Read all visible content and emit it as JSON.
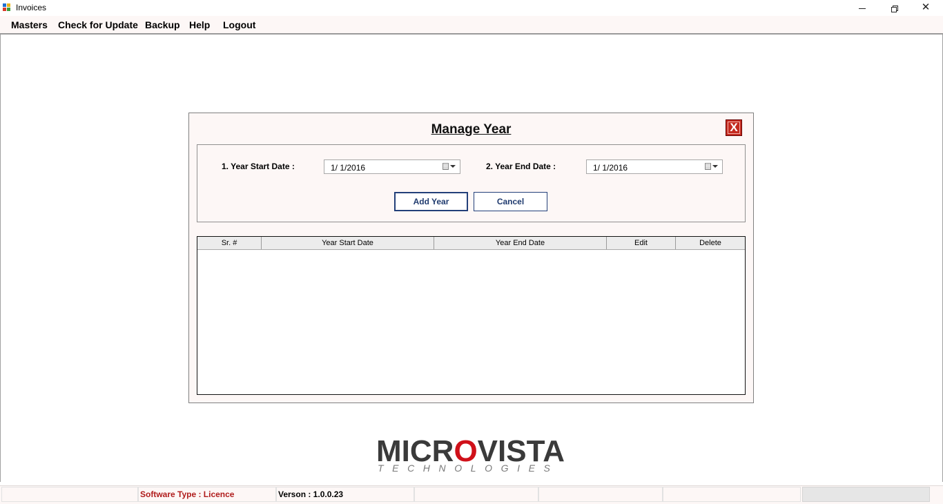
{
  "window": {
    "title": "Invoices",
    "controls": {
      "minimize": "",
      "maximize": "",
      "close": "✕"
    }
  },
  "menu": [
    {
      "label": "Masters"
    },
    {
      "label": "Check for Update"
    },
    {
      "label": "Backup"
    },
    {
      "label": "Help"
    },
    {
      "label": "Logout"
    }
  ],
  "dialog": {
    "title": "Manage Year",
    "close_label": "X",
    "start_date_label": "1. Year Start Date :",
    "start_date_value": "1/  1/2016",
    "end_date_label": "2. Year End Date :",
    "end_date_value": "1/  1/2016",
    "add_button": "Add Year",
    "cancel_button": "Cancel",
    "grid_columns": [
      "Sr. #",
      "Year Start Date",
      "Year End Date",
      "Edit",
      "Delete"
    ],
    "grid_rows": []
  },
  "logo": {
    "text_before": "MICR",
    "text_o": "O",
    "text_after": "VISTA",
    "subtitle": "TECHNOLOGIES"
  },
  "status": {
    "software_type": "Software Type : Licence",
    "version": "Verson : 1.0.0.23"
  },
  "colors": {
    "accent_red": "#c42a1f",
    "button_blue": "#223f79",
    "panel_bg": "#fdf7f6"
  },
  "icons": {
    "app": "app-icon",
    "calendar": "calendar-dropdown-icon",
    "close": "close-icon"
  }
}
